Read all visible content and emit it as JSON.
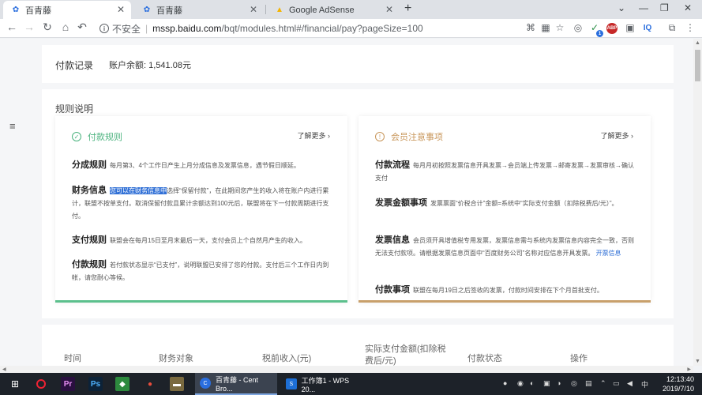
{
  "browser": {
    "tabs": [
      {
        "title": "百青藤",
        "active": true
      },
      {
        "title": "百青藤",
        "active": false
      },
      {
        "title": "Google AdSense",
        "active": false
      }
    ],
    "new_tab": "+",
    "window_controls": {
      "minimize": "—",
      "maximize": "❐",
      "close": "✕",
      "menu": "⌄"
    },
    "nav": {
      "back": "←",
      "forward": "→",
      "reload": "↻",
      "home": "⌂",
      "undo": "↶"
    },
    "address": {
      "info": "i",
      "security_label": "不安全",
      "separator": "|",
      "host": "mssp.baidu.com",
      "path": "/bqt/modules.html#/financial/pay?pageSize=100"
    },
    "extensions": {
      "abp_badge": "ABP",
      "iq_label": "IQ",
      "badge_count": "1"
    }
  },
  "summary": {
    "title": "付款记录",
    "balance_label": "账户余额:",
    "balance_value": "1,541.08元"
  },
  "side_menu_icon": "≡",
  "rules": {
    "title": "规则说明",
    "left_card": {
      "title": "付款规则",
      "more": "了解更多 ›",
      "items": [
        {
          "heading": "分成规则",
          "text": "每月第3、4个工作日产生上月分成信息及发票信息，遇节假日顺延。"
        },
        {
          "heading": "财务信息",
          "highlight": "您可以在财务信息中",
          "text_a": "选择“保留付款”，在此期间您产生的收入将在账户内进行累计，联盟不按单支付。取消保留付款且累计余额达到100元后，联盟将在下一付款周期进行支付。"
        },
        {
          "heading": "支付规则",
          "text": "联盟会在每月15日至月末最后一天，支付会员上个自然月产生的收入。"
        },
        {
          "heading": "付款规则",
          "text": "若付款状态显示“已支付”，说明联盟已安排了您的付款。支付后三个工作日内到帐，请您耐心等候。"
        }
      ]
    },
    "right_card": {
      "title": "会员注意事项",
      "more": "了解更多 ›",
      "items": [
        {
          "heading": "付款流程",
          "text": "每月月初按照发票信息开具发票→会员端上传发票→邮寄发票→发票审核→确认支付"
        },
        {
          "heading": "发票金额事项",
          "text": "发票票面“价税合计”金额=系统中“实际支付金额（扣除税费后/元）”。"
        },
        {
          "heading": "发票信息",
          "text": "会员须开具增值税专用发票，发票信息需与系统内发票信息内容完全一致，否则无法支付款项。请根据发票信息页面中“百度财务公司”名称对应信息开具发票。",
          "link": "开票信息"
        },
        {
          "heading": "付款事项",
          "text": "联盟在每月19日之后签收的发票，付款时间安排在下个月首批支付。"
        }
      ]
    }
  },
  "table": {
    "headers": [
      "时间",
      "财务对象",
      "税前收入(元)",
      "实际支付金额(扣除税费后/元)",
      "付款状态",
      "操作"
    ]
  },
  "taskbar": {
    "apps": [
      {
        "label": "百青藤 - Cent Bro...",
        "active": true
      },
      {
        "label": "工作簿1 - WPS 20...",
        "active": false
      }
    ],
    "time": "12:13:40",
    "date": "2019/7/10"
  },
  "colors": {
    "accent_green": "#5cc08d",
    "accent_gold": "#c8a06b",
    "link_blue": "#2f6fd6"
  }
}
